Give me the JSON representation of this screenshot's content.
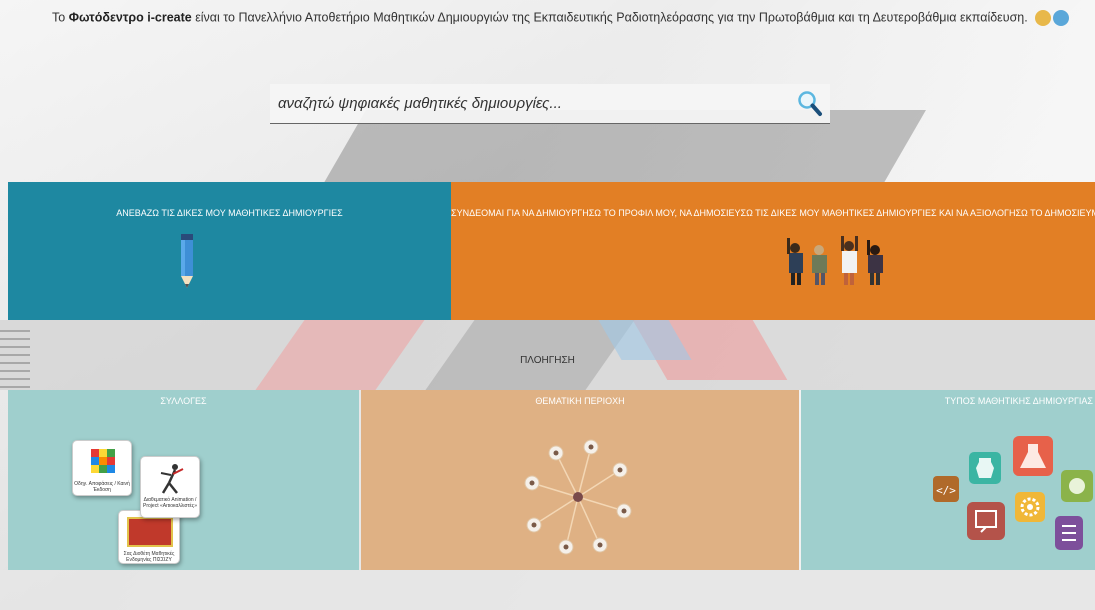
{
  "intro": {
    "prefix": "Το ",
    "brand": "Φωτόδεντρο i-create",
    "suffix": " είναι το Πανελλήνιο Αποθετήριο Μαθητικών Δημιουργιών της Εκπαιδευτικής Ραδιοτηλεόρασης για την Πρωτοβάθμια και τη Δευτεροβάθμια εκπαίδευση."
  },
  "search": {
    "placeholder": "αναζητώ ψηφιακές μαθητικές δημιουργίες..."
  },
  "tiles": {
    "upload": {
      "title": "ΑΝΕΒΑΖΩ ΤΙΣ ΔΙΚΕΣ ΜΟΥ ΜΑΘΗΤΙΚΕΣ ΔΗΜΙΟΥΡΓΙΕΣ",
      "color": "#1e88a1"
    },
    "login": {
      "title": "ΣΥΝΔΕΟΜΑΙ ΓΙΑ ΝΑ ΔΗΜΙΟΥΡΓΗΣΩ ΤΟ ΠΡΟΦΙΛ ΜΟΥ, ΝΑ ΔΗΜΟΣΙΕΥΣΩ ΤΙΣ ΔΙΚΕΣ ΜΟΥ ΜΑΘΗΤΙΚΕΣ ΔΗΜΙΟΥΡΓΙΕΣ ΚΑΙ ΝΑ ΑΞΙΟΛΟΓΗΣΩ ΤΟ ΔΗΜΟΣΙΕΥΜ",
      "color": "#e27f25"
    }
  },
  "navigation_label": "ΠΛΟΗΓΗΣΗ",
  "nav_tiles": {
    "collections": {
      "title": "ΣΥΛΛΟΓΕΣ",
      "color": "#9fcfcd",
      "cards": [
        {
          "caption": "Οδηγ. Αποφάσεις / Καινή Έκδοση"
        },
        {
          "caption": "Διαθεματικό Animation / Project «Αιτιοκαλλιστές»"
        },
        {
          "caption": "Σας Διοθέτη Μαθητικές Ενδομηνίες ΠΙΣΣΙΖΥ"
        }
      ]
    },
    "thematic": {
      "title": "ΘΕΜΑΤΙΚΗ ΠΕΡΙΟΧΗ",
      "color": "#dfb184"
    },
    "types": {
      "title": "ΤΥΠΟΣ ΜΑΘΗΤΙΚΗΣ ΔΗΜΙΟΥΡΓΙΑΣ",
      "color": "#9fcfcd"
    }
  },
  "icons": {
    "search": "magnifier-icon",
    "shield": "shield-icon",
    "pencil": "pencil-icon",
    "people": "students-cheering-icon",
    "network": "network-nodes-icon",
    "types": [
      "code-icon",
      "vase-icon",
      "flask-icon",
      "presentation-icon",
      "gear-icon",
      "puzzle-icon",
      "document-icon"
    ]
  }
}
